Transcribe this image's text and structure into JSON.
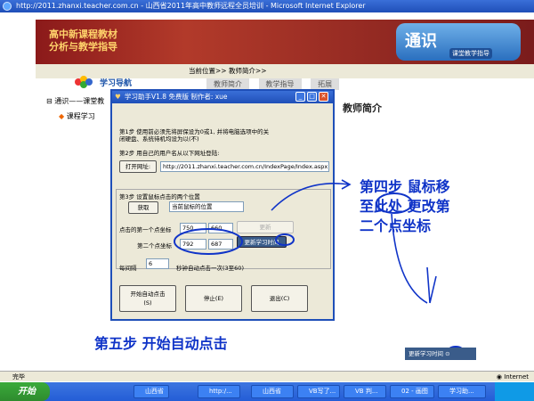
{
  "window": {
    "title": "http://2011.zhanxi.teacher.com.cn - 山西省2011年高中教师远程全员培训 - Microsoft Internet Explorer"
  },
  "banner": {
    "left_line1": "高中新课程教材",
    "left_line2": "分析与教学指导",
    "right_big": "通识",
    "right_small": "课堂教学指导"
  },
  "nav": {
    "badge": "学习导航",
    "crumb": "当前位置>> 教师简介>>",
    "tabs": [
      "教师简介",
      "教学指导",
      "拓展"
    ]
  },
  "tree": {
    "root": "通识——课堂教",
    "child": "课程学习"
  },
  "main": {
    "heading": "教师简介"
  },
  "dialog": {
    "title": "学习助手V1.8 免费版 制作者: xue",
    "step1_line1": "第1步 使用前必须先将屏保设为0或1, 并将电脑选项中的关",
    "step1_line2": "闭硬盘、系统待机均设为以(不)",
    "step2": "第2步 用自己的用户名从以下网址登陆:",
    "open_url_btn": "打开网址:",
    "url_value": "http://2011.zhanxi.teacher.com.cn/IndexPage/Index.aspx",
    "step3": "第3步 设置鼠标点击的两个位置",
    "get_btn": "获取",
    "current_pos": "当前鼠标的位置",
    "point1_label": "点击的第一个点坐标",
    "p1x": "750",
    "p1y": "660",
    "point2_label": "第二个点坐标",
    "p2x": "792",
    "p2y": "687",
    "ghost_btn": "更新",
    "update_btn": "更新学习时间",
    "interval_label": "每间隔",
    "interval_value": "6",
    "interval_suffix": "秒钟自动点击一次(3至60)",
    "start_btn_l1": "开始自动点击",
    "start_btn_l2": "(S)",
    "stop_btn": "停止(E)",
    "exit_btn": "退出(C)"
  },
  "annotations": {
    "step4_l1": "第四步  鼠标移",
    "step4_l2a": "至",
    "step4_l2b": "此处",
    "step4_l2c": " 更改第",
    "step4_l3": "二个点坐标",
    "step5": "第五步  开始自动点击"
  },
  "popup": {
    "label": "更新学习时间"
  },
  "status": {
    "left": "完毕",
    "right": "Internet"
  },
  "taskbar": {
    "start": "开始",
    "items": [
      "山西省",
      "http:/...",
      "山西省",
      "VB写了...",
      "VB 判...",
      "02 - 画图",
      "学习助..."
    ]
  },
  "colors": {
    "ie_blue": "#245dd6",
    "hand_blue": "#1034c8",
    "banner_red": "#8b1a1a"
  }
}
